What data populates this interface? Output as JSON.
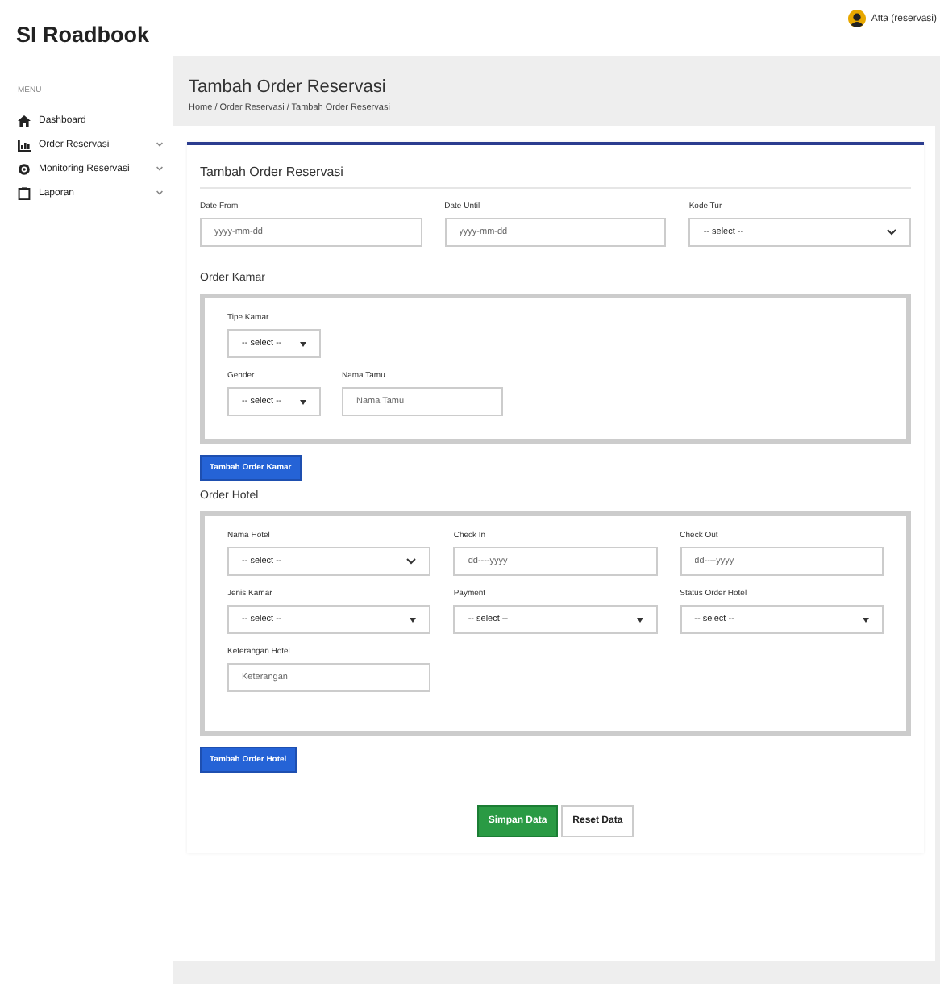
{
  "app": {
    "title": "SI Roadbook",
    "user": "Atta (reservasi)"
  },
  "sidebar": {
    "heading": "MENU",
    "items": [
      {
        "label": "Dashboard",
        "expandable": false
      },
      {
        "label": "Order Reservasi",
        "expandable": true
      },
      {
        "label": "Monitoring Reservasi",
        "expandable": true
      },
      {
        "label": "Laporan",
        "expandable": true
      }
    ]
  },
  "page": {
    "title": "Tambah Order Reservasi",
    "breadcrumb": "Home / Order Reservasi / Tambah Order Reservasi"
  },
  "form": {
    "title": "Tambah Order Reservasi",
    "top_fields": [
      {
        "label": "Date From",
        "kind": "text",
        "placeholder": "yyyy-mm-dd"
      },
      {
        "label": "Date Until",
        "kind": "text",
        "placeholder": "yyyy-mm-dd"
      },
      {
        "label": "Kode Tur",
        "kind": "select",
        "value": "-- select --"
      }
    ],
    "order_kamar": {
      "title": "Order Kamar",
      "rows": [
        [
          {
            "label": "Tipe Kamar",
            "kind": "dropdown",
            "value": "-- select --"
          }
        ],
        [
          {
            "label": "Gender",
            "kind": "dropdown",
            "value": "-- select --"
          },
          {
            "label": "Nama Tamu",
            "kind": "text",
            "placeholder": "Nama Tamu"
          }
        ]
      ],
      "button": "Tambah Order Kamar"
    },
    "order_hotel": {
      "title": "Order Hotel",
      "fields": [
        {
          "label": "Nama Hotel",
          "kind": "select",
          "value": "-- select --"
        },
        {
          "label": "Check In",
          "kind": "text",
          "placeholder": "dd----yyyy"
        },
        {
          "label": "Check Out",
          "kind": "text",
          "placeholder": "dd----yyyy"
        },
        {
          "label": "Jenis Kamar",
          "kind": "dropdown",
          "value": "-- select --"
        },
        {
          "label": "Payment",
          "kind": "dropdown",
          "value": "-- select --"
        },
        {
          "label": "Status Order Hotel",
          "kind": "dropdown",
          "value": "-- select --"
        },
        {
          "label": "Keterangan Hotel",
          "kind": "text",
          "placeholder": "Keterangan"
        }
      ],
      "button": "Tambah Order Hotel"
    },
    "actions": [
      {
        "label": "Simpan Data",
        "kind": "primary"
      },
      {
        "label": "Reset Data",
        "kind": "default"
      }
    ]
  }
}
